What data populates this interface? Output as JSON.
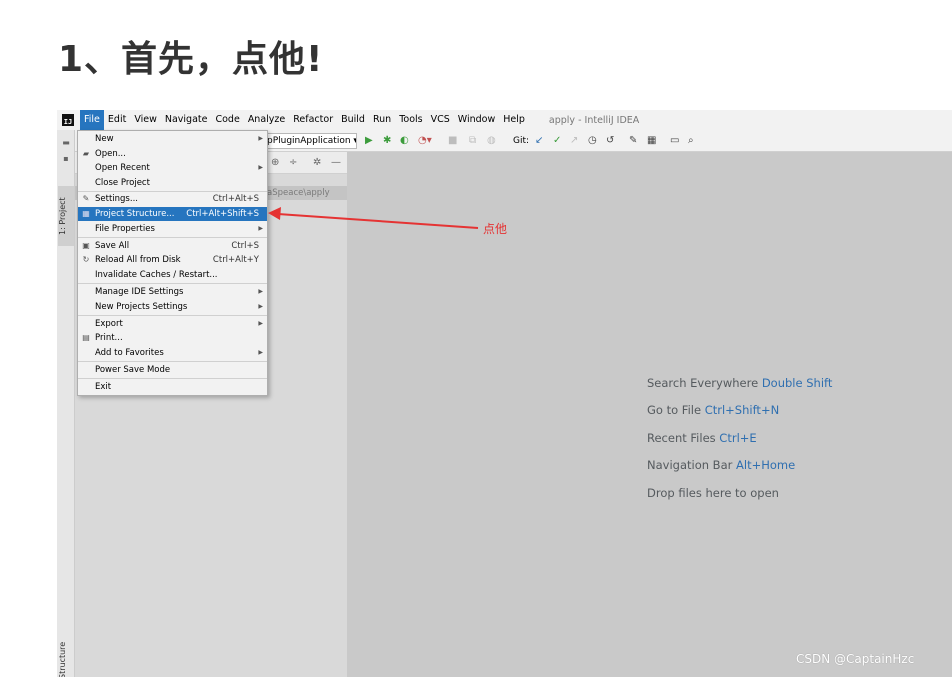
{
  "article": {
    "heading": "1、首先，点他!"
  },
  "window": {
    "title": "apply - IntelliJ IDEA",
    "logo_text": "IJ"
  },
  "menubar": {
    "items": [
      "File",
      "Edit",
      "View",
      "Navigate",
      "Code",
      "Analyze",
      "Refactor",
      "Build",
      "Run",
      "Tools",
      "VCS",
      "Window",
      "Help"
    ],
    "active": "File"
  },
  "toolbar": {
    "run_config": "pPluginApplication ▾",
    "git_label": "Git:"
  },
  "project_panel": {
    "path_text": "aSpeace\\apply"
  },
  "tool_windows": {
    "project_tab": "1: Project",
    "structure_tab": "Structure"
  },
  "file_menu": {
    "items": [
      {
        "label": "New",
        "keys": "",
        "submenu": true,
        "icon": ""
      },
      {
        "label": "Open...",
        "keys": "",
        "submenu": false,
        "icon": "folder-icon"
      },
      {
        "label": "Open Recent",
        "keys": "",
        "submenu": true,
        "icon": ""
      },
      {
        "label": "Close Project",
        "keys": "",
        "submenu": false,
        "icon": ""
      },
      {
        "label": "Settings...",
        "keys": "Ctrl+Alt+S",
        "submenu": false,
        "icon": "wrench-icon"
      },
      {
        "label": "Project Structure...",
        "keys": "Ctrl+Alt+Shift+S",
        "submenu": false,
        "icon": "project-structure-icon",
        "selected": true
      },
      {
        "label": "File Properties",
        "keys": "",
        "submenu": true,
        "icon": ""
      },
      {
        "label": "Save All",
        "keys": "Ctrl+S",
        "submenu": false,
        "icon": "save-icon"
      },
      {
        "label": "Reload All from Disk",
        "keys": "Ctrl+Alt+Y",
        "submenu": false,
        "icon": "reload-icon"
      },
      {
        "label": "Invalidate Caches / Restart...",
        "keys": "",
        "submenu": false,
        "icon": ""
      },
      {
        "label": "Manage IDE Settings",
        "keys": "",
        "submenu": true,
        "icon": ""
      },
      {
        "label": "New Projects Settings",
        "keys": "",
        "submenu": true,
        "icon": ""
      },
      {
        "label": "Export",
        "keys": "",
        "submenu": true,
        "icon": ""
      },
      {
        "label": "Print...",
        "keys": "",
        "submenu": false,
        "icon": "print-icon"
      },
      {
        "label": "Add to Favorites",
        "keys": "",
        "submenu": true,
        "icon": ""
      },
      {
        "label": "Power Save Mode",
        "keys": "",
        "submenu": false,
        "icon": ""
      },
      {
        "label": "Exit",
        "keys": "",
        "submenu": false,
        "icon": ""
      }
    ]
  },
  "editor_hints": [
    {
      "text": "Search Everywhere",
      "shortcut": "Double Shift"
    },
    {
      "text": "Go to File",
      "shortcut": "Ctrl+Shift+N"
    },
    {
      "text": "Recent Files",
      "shortcut": "Ctrl+E"
    },
    {
      "text": "Navigation Bar",
      "shortcut": "Alt+Home"
    },
    {
      "text": "Drop files here to open",
      "shortcut": ""
    }
  ],
  "annotation": {
    "text": "点他",
    "color": "#e53333"
  },
  "watermark": "CSDN @CaptainHzc"
}
